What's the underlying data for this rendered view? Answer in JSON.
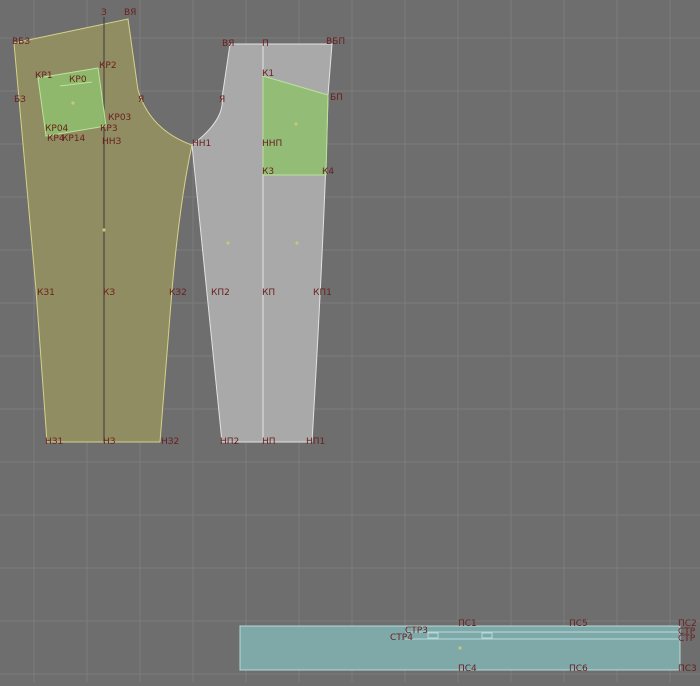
{
  "viewport": {
    "background": "#6e6e6e",
    "grid_color": "#7c7c7c"
  },
  "colors": {
    "back_fill": "#918d62",
    "back_stroke": "#d4d28a",
    "front_fill": "#a9a9a9",
    "front_stroke": "#e2e2e2",
    "pocket_fill": "#8fbf6f",
    "pocket_stroke": "#b8e49a",
    "waistband_fill": "#7fa9a9",
    "waistband_stroke": "#b4dada",
    "label_color": "#6a1e1e",
    "point_color": "#c7c77a"
  },
  "labels": {
    "back": {
      "z": "З",
      "vya": "ВЯ",
      "vbz": "ВБЗ",
      "bz": "БЗ",
      "ya": "Я",
      "kr1": "КР1",
      "kr0": "КР0",
      "kr2": "КР2",
      "kr03": "КР03",
      "kr04": "КР04",
      "kr3": "КР3",
      "kr4": "КР4",
      "kr14": "КР14",
      "nnz": "ННЗ",
      "kz1": "КЗ1",
      "kz": "КЗ",
      "kz2": "КЗ2",
      "nz1": "НЗ1",
      "nz": "НЗ",
      "nz2": "НЗ2"
    },
    "front": {
      "vya": "ВЯ",
      "p": "П",
      "vbp": "ВБП",
      "k1": "К1",
      "ya": "Я",
      "bp": "БП",
      "nn1": "НН1",
      "nnp": "ННП",
      "k3": "К3",
      "k4": "К4",
      "kp2": "КП2",
      "kp": "КП",
      "kp1": "КП1",
      "np2": "НП2",
      "np": "НП",
      "np1": "НП1"
    },
    "waistband": {
      "ps1": "ПС1",
      "ps5": "ПС5",
      "ps2": "ПС2",
      "str3": "СТР3",
      "str4": "СТР4",
      "str1": "СТР",
      "str2": "СТР",
      "ps4": "ПС4",
      "ps6": "ПС6",
      "ps3": "ПС3"
    }
  }
}
